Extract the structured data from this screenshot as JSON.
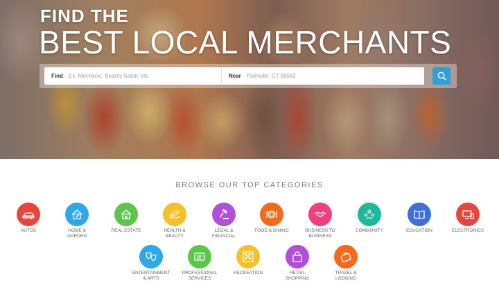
{
  "hero": {
    "kicker": "FIND THE",
    "title": "BEST LOCAL MERCHANTS"
  },
  "search": {
    "find_label": "Find",
    "find_placeholder": "Ex. Mechanic, Beauty Salon, etc",
    "near_label": "Near",
    "near_placeholder": "Plainville, CT 06062",
    "button_icon": "search-icon"
  },
  "categories": {
    "heading": "BROWSE OUR TOP CATEGORIES",
    "items": [
      {
        "label": "AUTOS",
        "color": "#e8453c",
        "icon": "car-icon"
      },
      {
        "label": "HOME &\nGARDEN",
        "color": "#2ea8e8",
        "icon": "house-icon"
      },
      {
        "label": "REAL ESTATE",
        "color": "#5cc64b",
        "icon": "building-icon"
      },
      {
        "label": "HEALTH &\nBEAUTY",
        "color": "#f2c12e",
        "icon": "leaf-hand-icon"
      },
      {
        "label": "LEGAL &\nFINANCIAL",
        "color": "#b04fd8",
        "icon": "gavel-icon"
      },
      {
        "label": "FOOD & DINING",
        "color": "#f26b1d",
        "icon": "plate-icon"
      },
      {
        "label": "BUSINESS TO\nBUSINESS",
        "color": "#ef3f7d",
        "icon": "handshake-icon"
      },
      {
        "label": "COMMUNITY",
        "color": "#1fb89a",
        "icon": "people-icon"
      },
      {
        "label": "EDUCATION",
        "color": "#3f6fd8",
        "icon": "book-icon"
      },
      {
        "label": "ELECTRONICS",
        "color": "#e8453c",
        "icon": "devices-icon"
      },
      {
        "label": "ENTERTAINMENT\n& ARTS",
        "color": "#2ea8e8",
        "icon": "masks-icon"
      },
      {
        "label": "PROFESSIONAL\nSERVICES",
        "color": "#5cc64b",
        "icon": "id-card-icon"
      },
      {
        "label": "RECREATION",
        "color": "#f2c12e",
        "icon": "board-icon"
      },
      {
        "label": "RETAIL\nSHOPPING",
        "color": "#b04fd8",
        "icon": "shopping-bag-icon"
      },
      {
        "label": "TRAVEL &\nLODGING",
        "color": "#f26b1d",
        "icon": "suitcase-icon"
      }
    ]
  }
}
